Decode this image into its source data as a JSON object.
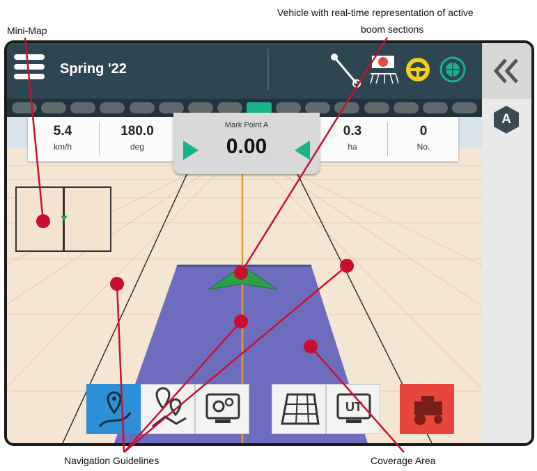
{
  "callouts": {
    "minimap": "Mini-Map",
    "vehicle_line1": "Vehicle with real-time representation of active",
    "vehicle_line2": "boom sections",
    "guidelines": "Navigation Guidelines",
    "coverage": "Coverage Area"
  },
  "header": {
    "title": "Spring '22"
  },
  "readouts": {
    "speed": {
      "value": "5.4",
      "unit": "km/h"
    },
    "heading": {
      "value": "180.0",
      "unit": "deg"
    },
    "area": {
      "value": "0.3",
      "unit": "ha"
    },
    "count": {
      "value": "0",
      "unit": "No."
    }
  },
  "crosstrack": {
    "label": "Mark Point A",
    "value": "0.00"
  },
  "sidebar": {
    "badge": "A"
  },
  "boom_sections": {
    "total": 16,
    "active_index": 8
  },
  "colors": {
    "header": "#2e4652",
    "section_active": "#19b28a",
    "coverage": "#6e6cbf",
    "guideline": "#e89a3a",
    "callout_marker": "#c8102e",
    "tool_blue": "#2c8fd7",
    "tool_red": "#e8453c"
  },
  "icons": {
    "menu": "hamburger-menu-icon",
    "boom": "boom-angle-icon",
    "implement": "implement-status-icon",
    "steering": "steering-wheel-icon",
    "gnss": "gnss-globe-icon",
    "collapse": "double-chevron-left-icon",
    "guidance_mode": "guidance-mode-a-icon",
    "tools": [
      "guidance-marker-icon",
      "marked-points-icon",
      "system-settings-icon",
      "field-mapping-icon",
      "ut-terminal-icon",
      "tractor-implement-icon"
    ]
  }
}
